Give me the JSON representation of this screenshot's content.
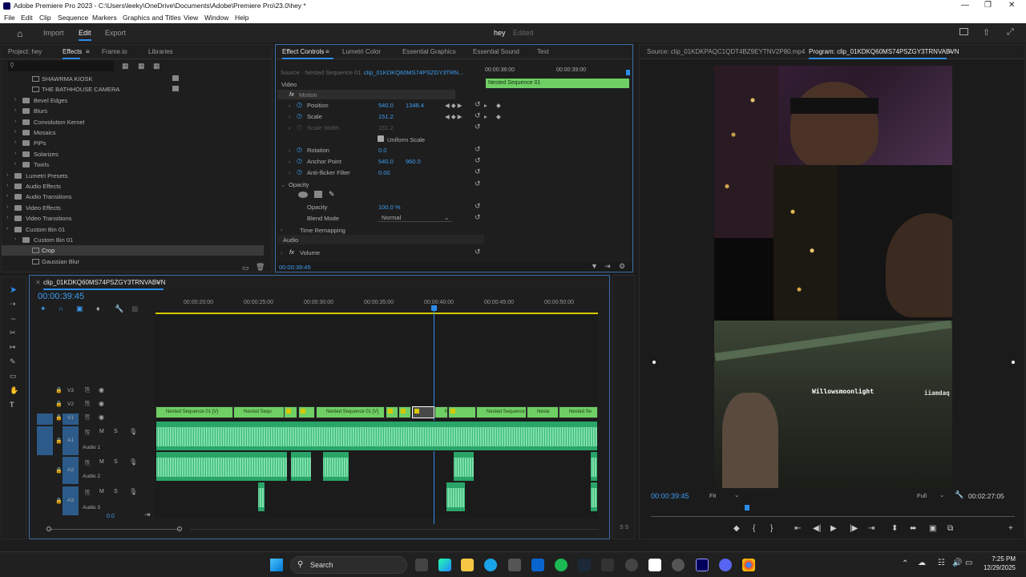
{
  "window": {
    "title": "Adobe Premiere Pro 2023 - C:\\Users\\leeky\\OneDrive\\Documents\\Adobe\\Premiere Pro\\23.0\\hey *"
  },
  "menu": [
    "File",
    "Edit",
    "Clip",
    "Sequence",
    "Markers",
    "Graphics and Titles",
    "View",
    "Window",
    "Help"
  ],
  "workspace": {
    "tabs": [
      "Import",
      "Edit",
      "Export"
    ],
    "active": "Edit",
    "project_name": "hey",
    "status": "Edited"
  },
  "effects_panel": {
    "tabs": [
      "Project: hey",
      "Effects",
      "Frame.io",
      "Libraries"
    ],
    "active_tab": "Effects",
    "search_placeholder": "",
    "items": [
      {
        "label": "SHAWRMA KIOSK",
        "indent": 2,
        "type": "preset"
      },
      {
        "label": "THE BATHHOUSE CAMERA",
        "indent": 2,
        "type": "preset"
      },
      {
        "label": "Bevel Edges",
        "indent": 1,
        "type": "folder"
      },
      {
        "label": "Blurs",
        "indent": 1,
        "type": "folder"
      },
      {
        "label": "Convolution Kernel",
        "indent": 1,
        "type": "folder"
      },
      {
        "label": "Mosaics",
        "indent": 1,
        "type": "folder"
      },
      {
        "label": "PiPs",
        "indent": 1,
        "type": "folder"
      },
      {
        "label": "Solarizes",
        "indent": 1,
        "type": "folder"
      },
      {
        "label": "Twirls",
        "indent": 1,
        "type": "folder"
      },
      {
        "label": "Lumetri Presets",
        "indent": 0,
        "type": "folder"
      },
      {
        "label": "Audio Effects",
        "indent": 0,
        "type": "folder"
      },
      {
        "label": "Audio Transitions",
        "indent": 0,
        "type": "folder"
      },
      {
        "label": "Video Effects",
        "indent": 0,
        "type": "folder"
      },
      {
        "label": "Video Transitions",
        "indent": 0,
        "type": "folder"
      },
      {
        "label": "Custom Bin 01",
        "indent": 0,
        "type": "folder"
      },
      {
        "label": "Custom Bin 01",
        "indent": 1,
        "type": "folder"
      },
      {
        "label": "Crop",
        "indent": 2,
        "type": "effect",
        "selected": true
      },
      {
        "label": "Gaussian Blur",
        "indent": 2,
        "type": "effect"
      }
    ]
  },
  "effect_controls": {
    "tabs": [
      "Effect Controls",
      "Lumetri Color",
      "Essential Graphics",
      "Essential Sound",
      "Text"
    ],
    "active_tab": "Effect Controls",
    "source_label": "Source · Nested Sequence 01",
    "clip_label": "clip_01KDKQ60MS74PSZGY3TRN...",
    "time_start": "00:00:38:00",
    "time_end": "00:00:39:00",
    "nested_bar": "Nested Sequence 01",
    "video_header": "Video",
    "motion": "Motion",
    "properties": [
      {
        "name": "Position",
        "v1": "540.0",
        "v2": "1348.4"
      },
      {
        "name": "Scale",
        "v1": "151.2",
        "v2": ""
      },
      {
        "name": "Scale Width",
        "v1": "151.2",
        "v2": "",
        "disabled": true
      },
      {
        "name": "Rotation",
        "v1": "0.0",
        "v2": ""
      },
      {
        "name": "Anchor Point",
        "v1": "540.0",
        "v2": "960.0"
      },
      {
        "name": "Anti-flicker Filter",
        "v1": "0.00",
        "v2": ""
      }
    ],
    "uniform_scale": "Uniform Scale",
    "opacity_header": "Opacity",
    "opacity_label": "Opacity",
    "opacity_value": "100.0 %",
    "blend_mode_label": "Blend Mode",
    "blend_mode_value": "Normal",
    "time_remapping": "Time Remapping",
    "audio_header": "Audio",
    "volume": "Volume",
    "timecode": "00:00:39:45"
  },
  "program_monitor": {
    "source_tab": "Source: clip_01KDKPAQC1QDT4BZ9EYTNV2P80.mp4",
    "program_tab": "Program: clip_01KDKQ60MS74PSZGY3TRNVABVN",
    "timecode": "00:00:39:45",
    "fit": "Fit",
    "resolution": "Full",
    "duration": "00:02:27:05",
    "overlay_name1": "Willowsmoonlight",
    "overlay_name2": "iiamdaq"
  },
  "timeline": {
    "sequence_name": "clip_01KDKQ60MS74PSZGY3TRNVABVN",
    "timecode": "00:00:39:45",
    "ruler": [
      "00:00:20:00",
      "00:00:25:00",
      "00:00:30:00",
      "00:00:35:00",
      "00:00:40:00",
      "00:00:45:00",
      "00:00:50:00"
    ],
    "video_tracks": [
      "V3",
      "V2",
      "V1"
    ],
    "audio_tracks": [
      {
        "id": "A1",
        "name": "Audio 1"
      },
      {
        "id": "A2",
        "name": "Audio 2"
      },
      {
        "id": "A3",
        "name": "Audio 3"
      }
    ],
    "master_value": "0.0",
    "v1_clip_labels": [
      "Nested Sequence 01 [V]",
      "Nested Sequ",
      "Nested Sequence 01 [V]",
      "Nested",
      "Nested Sequence 0",
      "Neste",
      "Nested Se"
    ],
    "ss": "S S"
  },
  "taskbar": {
    "search": "Search",
    "time": "7:25 PM",
    "date": "12/29/2025"
  }
}
